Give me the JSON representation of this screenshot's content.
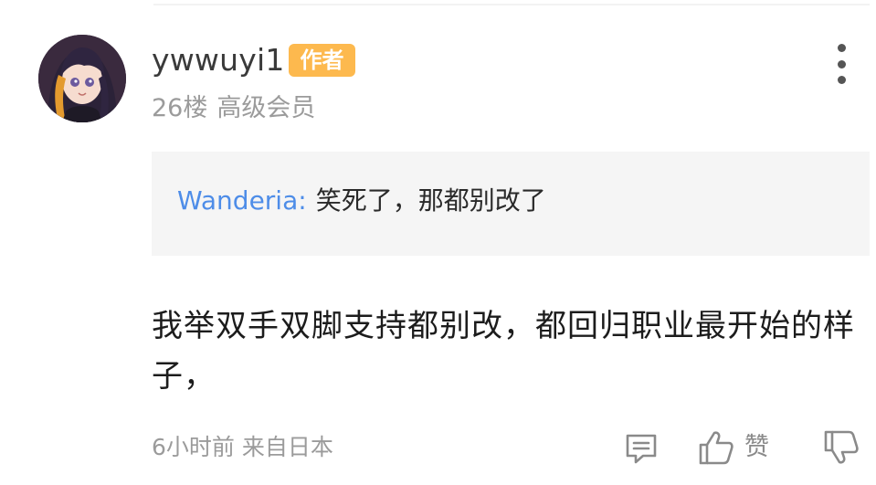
{
  "user": {
    "name": "ywwuyi1",
    "badge": "作者",
    "floor": "26楼",
    "level": "高级会员"
  },
  "quote": {
    "author": "Wanderia:",
    "text": "笑死了，那都别改了"
  },
  "comment": {
    "text": "我举双手双脚支持都别改，都回归职业最开始的样子，"
  },
  "footer": {
    "time": "6小时前",
    "location": "来自日本",
    "like_label": "赞"
  },
  "colors": {
    "badge": "#fdb94e",
    "quote_author": "#4e8de8",
    "meta": "#9b9b9b",
    "quote_bg": "#f5f5f5"
  },
  "icons": {
    "more": "vertical-ellipsis-icon",
    "reply": "comment-reply-icon",
    "like": "thumbs-up-icon",
    "dislike": "thumbs-down-icon"
  }
}
